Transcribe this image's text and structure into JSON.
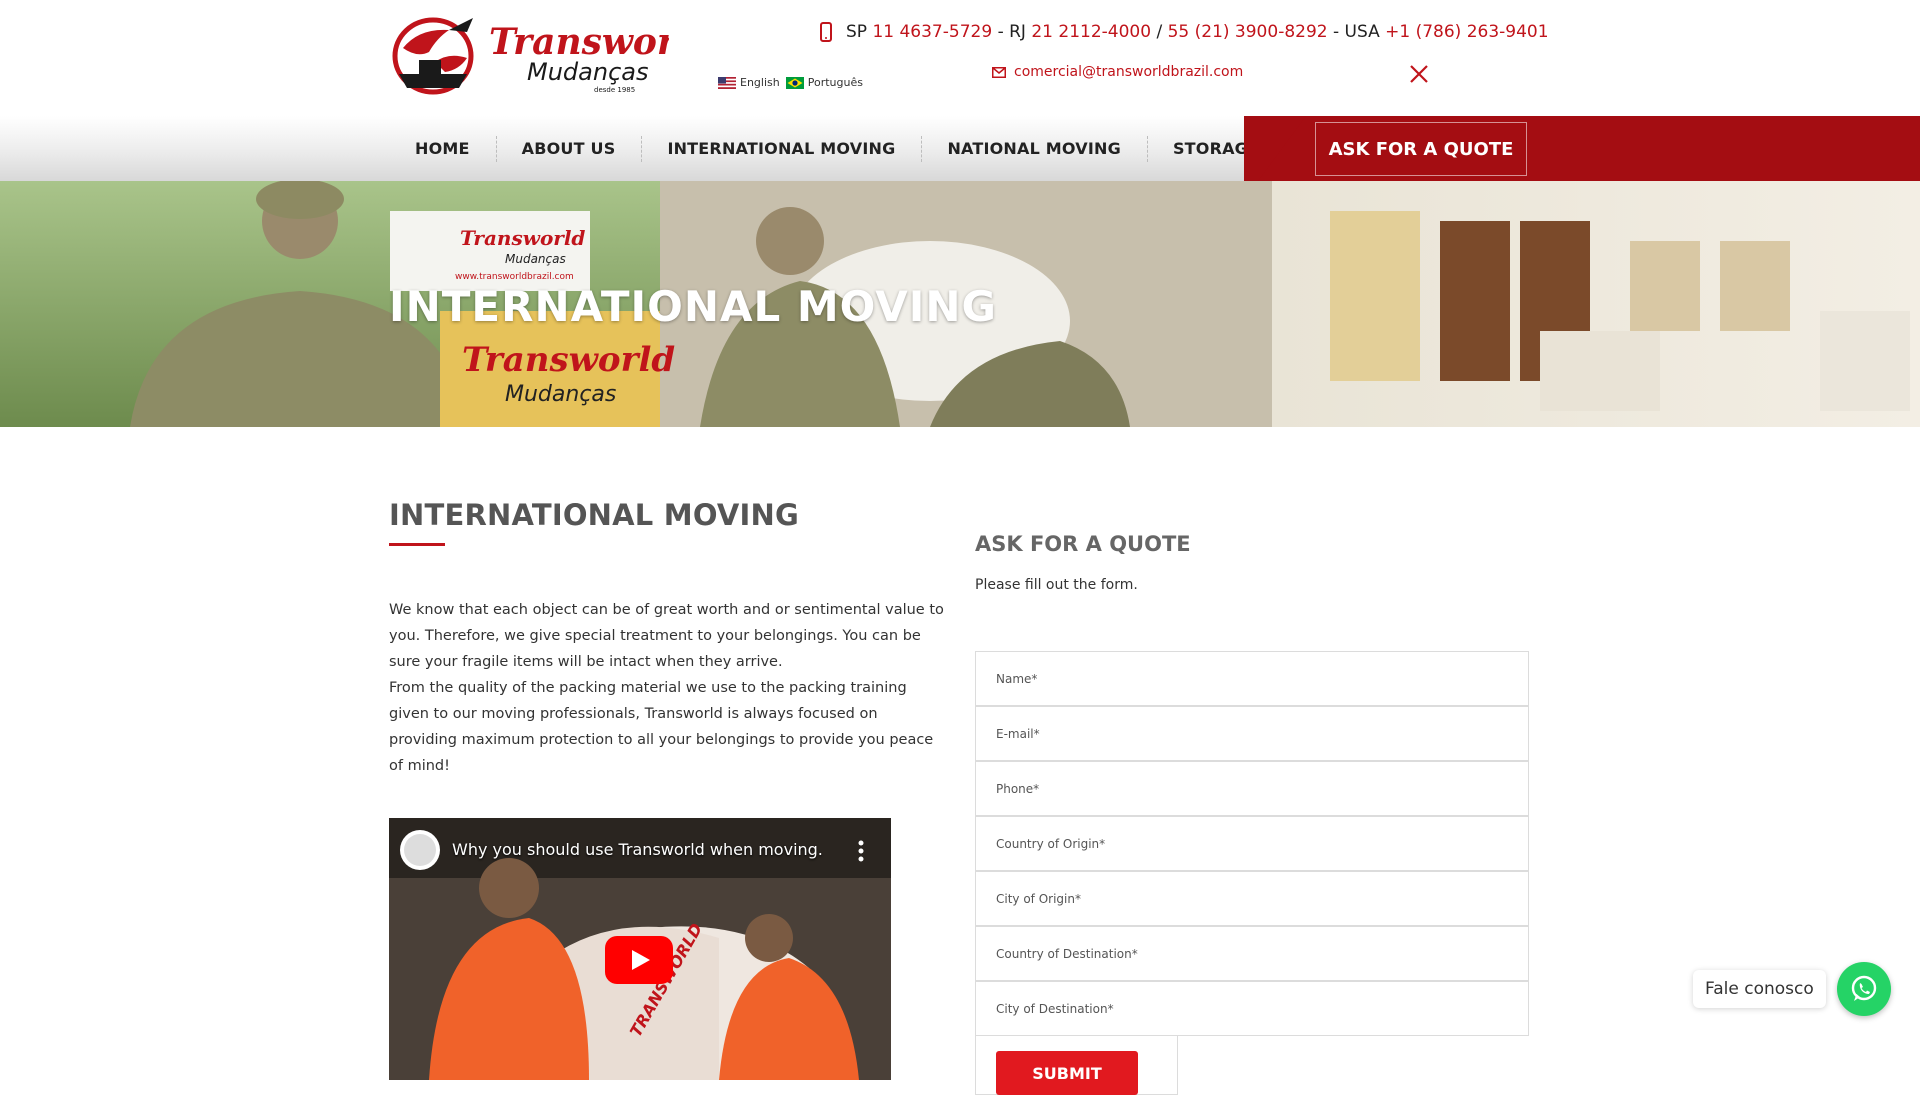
{
  "brand": {
    "name": "Transworld",
    "sub": "Mudanças",
    "since": "desde 1985"
  },
  "header": {
    "phones": [
      {
        "region": "SP",
        "number": "11 4637-5729"
      },
      {
        "sep": "- RJ",
        "number": "21 2112-4000"
      },
      {
        "sep": "/",
        "number": "55 (21) 3900-8292"
      },
      {
        "sep": "- USA",
        "number": "+1 (786) 263-9401"
      }
    ],
    "languages": [
      "English",
      "Português"
    ],
    "email": "comercial@transworldbrazil.com"
  },
  "nav": {
    "items": [
      "HOME",
      "ABOUT US",
      "INTERNATIONAL MOVING",
      "NATIONAL MOVING",
      "STORAGE"
    ],
    "quote_button": "ASK FOR A QUOTE"
  },
  "hero": {
    "title": "INTERNATIONAL MOVING",
    "truck_brand": "Transworld",
    "truck_sub": "Mudanças",
    "truck_url": "www.transworldbrazil.com"
  },
  "main": {
    "title": "INTERNATIONAL MOVING",
    "paragraphs": [
      "We know that each object can be of great worth and or sentimental value to you. Therefore, we give special treatment to your belongings. You can be sure your fragile items will be intact when they arrive.",
      "From the quality of the packing material we use to the packing training given to our moving professionals, Transworld is always focused on providing maximum protection to all your belongings to provide you peace of mind!"
    ],
    "video": {
      "title": "Why you should use Transworld when moving.",
      "panel_text": "TRANSWORLD"
    }
  },
  "form": {
    "title": "ASK FOR A QUOTE",
    "subtitle": "Please fill out the form.",
    "fields": [
      "Name*",
      "E-mail*",
      "Phone*",
      "Country of Origin*",
      "City of Origin*",
      "Country of Destination*",
      "City of Destination*"
    ],
    "submit": "SUBMIT"
  },
  "chat": {
    "label": "Fale conosco"
  },
  "colors": {
    "brand_red": "#c0141b",
    "nav_red": "#a40d12",
    "navy": "#1f3e63",
    "whatsapp": "#25d366"
  }
}
